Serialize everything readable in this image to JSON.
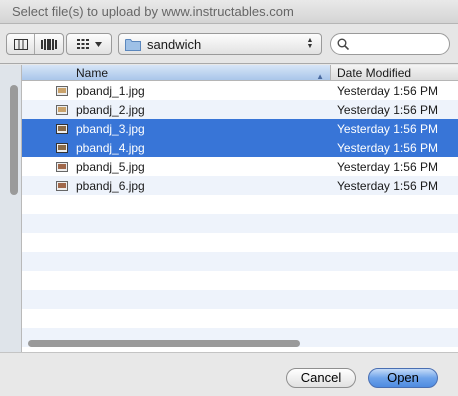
{
  "window": {
    "title": "Select file(s) to upload by www.instructables.com"
  },
  "toolbar": {
    "view_buttons": [
      "columns-view-icon",
      "coverflow-view-icon"
    ],
    "arrange_icon": "grid-arrange-icon",
    "location": {
      "folder_name": "sandwich",
      "icon": "folder-icon"
    },
    "search": {
      "icon": "magnifier-icon",
      "value": "",
      "placeholder": ""
    }
  },
  "file_list": {
    "columns": {
      "name": "Name",
      "date": "Date Modified"
    },
    "sort": {
      "column": "Name",
      "direction": "ascending"
    },
    "rows": [
      {
        "name": "pbandj_1.jpg",
        "date": "Yesterday 1:56 PM",
        "selected": false
      },
      {
        "name": "pbandj_2.jpg",
        "date": "Yesterday 1:56 PM",
        "selected": false
      },
      {
        "name": "pbandj_3.jpg",
        "date": "Yesterday 1:56 PM",
        "selected": true
      },
      {
        "name": "pbandj_4.jpg",
        "date": "Yesterday 1:56 PM",
        "selected": true
      },
      {
        "name": "pbandj_5.jpg",
        "date": "Yesterday 1:56 PM",
        "selected": false
      },
      {
        "name": "pbandj_6.jpg",
        "date": "Yesterday 1:56 PM",
        "selected": false
      }
    ]
  },
  "footer": {
    "cancel_label": "Cancel",
    "open_label": "Open"
  },
  "colors": {
    "selection": "#3875d7",
    "default_button": "#6ea3ea"
  }
}
